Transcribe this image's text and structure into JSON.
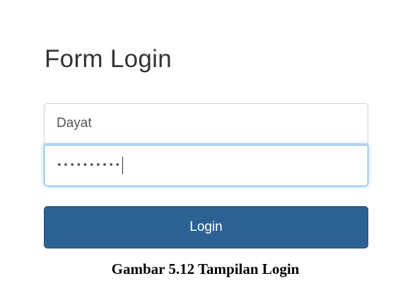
{
  "form": {
    "title": "Form Login",
    "username_value": "Dayat",
    "password_mask": "••••••••••",
    "login_label": "Login"
  },
  "caption": "Gambar 5.12 Tampilan Login",
  "colors": {
    "button_background": "#2c6193",
    "focus_border": "#66afe9"
  }
}
